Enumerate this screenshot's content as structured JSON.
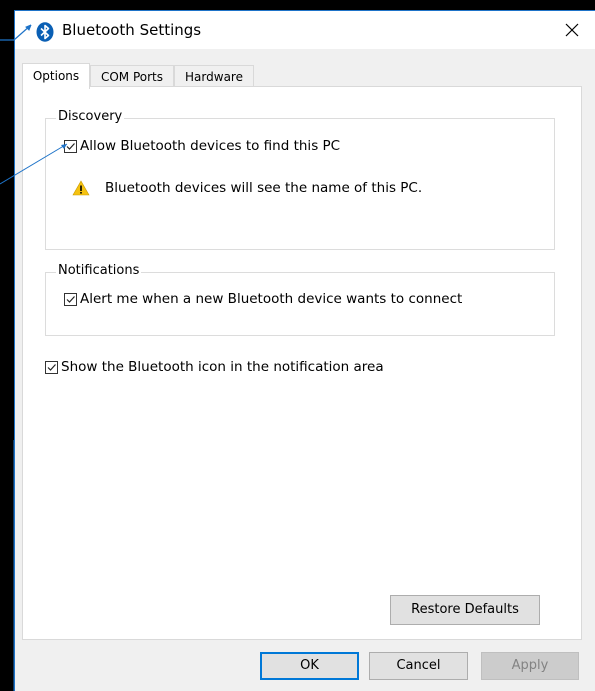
{
  "window": {
    "title": "Bluetooth Settings",
    "icon": "bluetooth-icon",
    "close_icon": "close-icon"
  },
  "tabs": [
    {
      "label": "Options",
      "active": true
    },
    {
      "label": "COM Ports",
      "active": false
    },
    {
      "label": "Hardware",
      "active": false
    }
  ],
  "discovery": {
    "group_label": "Discovery",
    "allow_label": "Allow Bluetooth devices to find this PC",
    "allow_checked": true,
    "warning_text": "Bluetooth devices will see the name of this PC.",
    "warning_icon": "warning-icon"
  },
  "notifications": {
    "group_label": "Notifications",
    "alert_label": "Alert me when a new Bluetooth device wants to connect",
    "alert_checked": true
  },
  "show_icon": {
    "label": "Show the Bluetooth icon in the notification area",
    "checked": true
  },
  "buttons": {
    "restore_defaults": "Restore Defaults",
    "ok": "OK",
    "cancel": "Cancel",
    "apply": "Apply"
  },
  "colors": {
    "accent": "#0078d7",
    "bluetooth_blue": "#0a5fb4",
    "warning_yellow": "#f5c211"
  }
}
